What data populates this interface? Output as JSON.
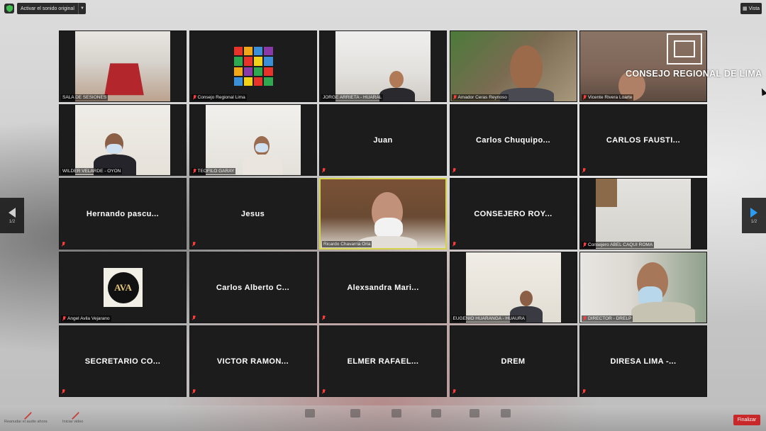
{
  "toolbar": {
    "original_sound_label": "Activar el sonido original",
    "view_label": "Vista"
  },
  "pagination": {
    "left": "1/2",
    "right": "1/2"
  },
  "overlay": {
    "logo_text": "CONSEJO REGIONAL DE LIMA"
  },
  "tiles": [
    {
      "label": "SALA DE SESIONES"
    },
    {
      "label": "Consejo Regional Lima"
    },
    {
      "label": "JORGE ARRIETA - HUARAL"
    },
    {
      "label": "Amador Ceras Reynoso"
    },
    {
      "label": "Vicente Rivera Loarte"
    },
    {
      "label": "WILDER VELARDE - OYON"
    },
    {
      "label": "TEOFILO GARAY"
    },
    {
      "name": "Juan"
    },
    {
      "name": "Carlos  Chuquipo..."
    },
    {
      "name": "CARLOS  FAUSTI..."
    },
    {
      "name": "Hernando  pascu..."
    },
    {
      "name": "Jesus"
    },
    {
      "label": "Ricardo Chavarria Oria"
    },
    {
      "name": "CONSEJERO  ROY..."
    },
    {
      "label": "Consejero ABEL CAQUI ROMA"
    },
    {
      "label": "Angel Avila Vejarano",
      "logo_text": "AVA"
    },
    {
      "name": "Carlos  Alberto  C..."
    },
    {
      "name": "Alexsandra  Mari..."
    },
    {
      "label": "EUGENIO HUARANGA - HUAURA"
    },
    {
      "label": "DIRECTOR - DRELP"
    },
    {
      "name": "SECRETARIO  CO..."
    },
    {
      "name": "VICTOR  RAMON..."
    },
    {
      "name": "ELMER  RAFAEL..."
    },
    {
      "name": "DREM"
    },
    {
      "name": "DIRESA  LIMA  -..."
    }
  ],
  "bottom_bar": {
    "items": [
      "Reanudar el audio ahora",
      "Iniciar video"
    ],
    "end_label": "Finalizar"
  },
  "colors": {
    "active_border": "#d6d24a",
    "muted_mic": "#ff3b3b",
    "end_button": "#c8282a"
  }
}
